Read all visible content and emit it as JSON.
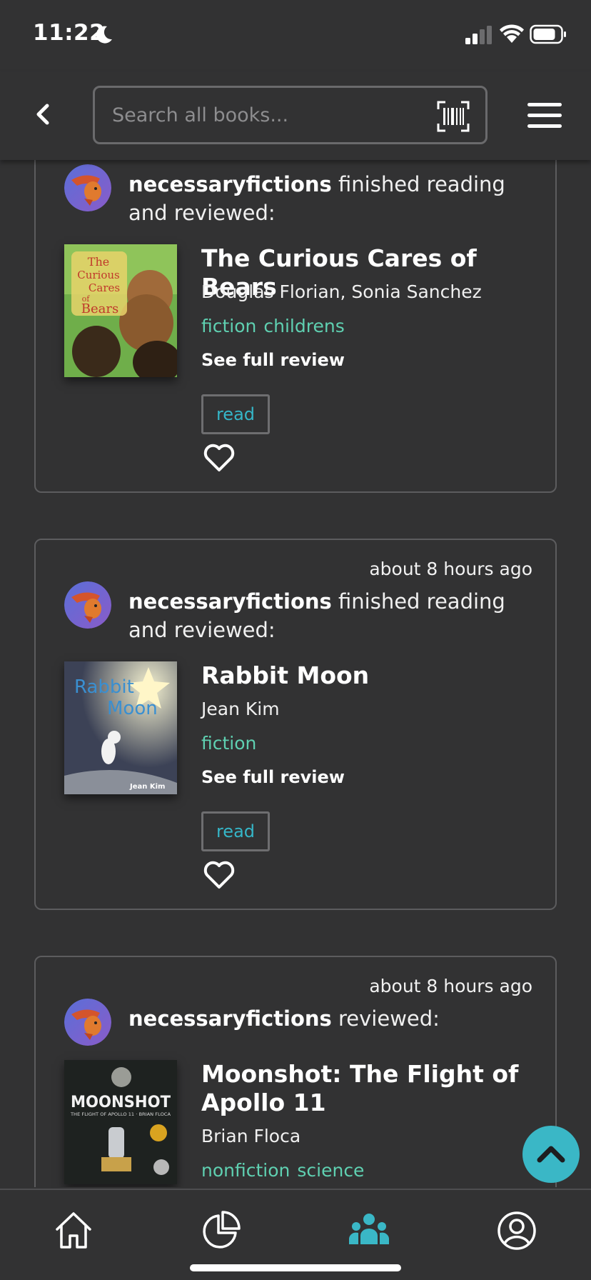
{
  "status_bar": {
    "time": "11:22"
  },
  "header": {
    "search_placeholder": "Search all books..."
  },
  "feed": [
    {
      "time": "",
      "user": "necessaryfictions",
      "action": " finished reading and reviewed:",
      "book": {
        "title": "The Curious Cares of Bears",
        "author": "Douglas Florian, Sonia Sanchez",
        "tags": [
          "fiction",
          "childrens"
        ],
        "cover_text": [
          "The",
          "Curious",
          "Cares",
          "of",
          "Bears"
        ]
      },
      "see_review": "See full review",
      "shelf": "read"
    },
    {
      "time": "about 8 hours ago",
      "user": "necessaryfictions",
      "action": " finished reading and reviewed:",
      "book": {
        "title": "Rabbit Moon",
        "author": "Jean Kim",
        "tags": [
          "fiction"
        ],
        "cover_text": [
          "Rabbit",
          "Moon",
          "Jean Kim"
        ]
      },
      "see_review": "See full review",
      "shelf": "read"
    },
    {
      "time": "about 8 hours ago",
      "user": "necessaryfictions",
      "action": " reviewed:",
      "book": {
        "title": "Moonshot: The Flight of Apollo 11",
        "author": "Brian Floca",
        "tags": [
          "nonfiction",
          "science"
        ],
        "cover_text": [
          "MOONSHOT",
          "THE FLIGHT OF APOLLO 11 · BRIAN FLOCA"
        ]
      }
    }
  ],
  "colors": {
    "background": "#323233",
    "accent": "#3ab7c6",
    "tag": "#5fd0b1",
    "border": "#5c5c5e"
  },
  "icons": {
    "status": [
      "moon-icon",
      "signal-icon",
      "wifi-icon",
      "battery-icon"
    ],
    "header": [
      "back-icon",
      "barcode-icon",
      "hamburger-menu-icon"
    ],
    "nav": [
      "home-icon",
      "pie-chart-icon",
      "community-icon",
      "profile-icon"
    ]
  },
  "nav": {
    "active": "community"
  }
}
